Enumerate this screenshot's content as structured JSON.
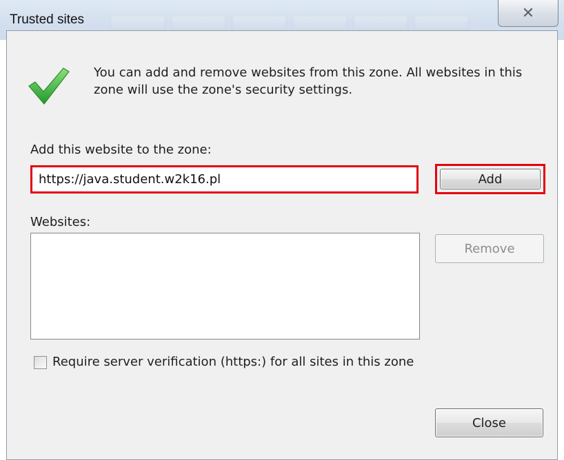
{
  "window": {
    "title": "Trusted sites",
    "close_glyph": "✕"
  },
  "info": {
    "icon": "check-mark-icon",
    "text": "You can add and remove websites from this zone. All websites in this zone will use the zone's security settings."
  },
  "add_site": {
    "label": "Add this website to the zone:",
    "value": "https://java.student.w2k16.pl",
    "button_label": "Add"
  },
  "websites": {
    "label": "Websites:",
    "items": [],
    "remove_label": "Remove"
  },
  "verification": {
    "label": "Require server verification (https:) for all sites in this zone",
    "checked": false
  },
  "footer": {
    "close_label": "Close"
  },
  "colors": {
    "highlight_red": "#e3000f",
    "check_green": "#3cb043"
  }
}
